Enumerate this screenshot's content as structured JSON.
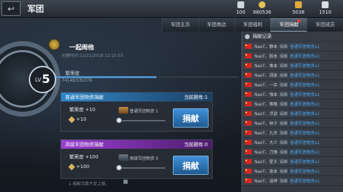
{
  "header": {
    "back_icon": "back-arrow-icon",
    "title": "军团",
    "resources": [
      {
        "icon": "silver-bar-icon",
        "value": "100",
        "color": "#cfd6dc"
      },
      {
        "icon": "coin-icon",
        "value": "980536",
        "color": "#e2c35a"
      },
      {
        "icon": "gold-bar-icon",
        "value": "5038",
        "color": "#e0a93a"
      },
      {
        "icon": "ticket-icon",
        "value": "1510",
        "color": "#d9dee4"
      }
    ]
  },
  "tabs": [
    {
      "label": "军团主页",
      "active": false
    },
    {
      "label": "军团商店",
      "active": false
    },
    {
      "label": "军团福利",
      "active": false
    },
    {
      "label": "军团捐献",
      "active": true,
      "badge": true
    },
    {
      "label": "军团成员",
      "active": false
    }
  ],
  "player": {
    "name": "一起闹他",
    "created": "创建时间:11/21/2018 12:15:03"
  },
  "level": {
    "label": "LV",
    "value": "5"
  },
  "prosperity": {
    "label": "繁荣度",
    "value": "74140/135379",
    "progress": 0.548
  },
  "donations": [
    {
      "title": "普通军团物资捐献",
      "remaining": "当前拥有:1",
      "prosperity_gain": "繁荣度 +10",
      "resource_gain": "+10",
      "supply_text": "普通军团物资  1",
      "button": "捐献",
      "color": "#2f86c8"
    },
    {
      "title": "高级军团物资捐献",
      "remaining": "当前拥有:0",
      "prosperity_gain": "繁荣度 +100",
      "resource_gain": "+100",
      "supply_text": "高级军团物资  0",
      "button": "捐献",
      "color": "#9a3fd1"
    }
  ],
  "bottom_hint": "1.捐献次数不足上限,",
  "bottom_hint_2": "",
  "log": {
    "title": "捐献记录",
    "rows": [
      {
        "name": "NaoT、静本",
        "action": "捐献",
        "item": "普通军团物资x1"
      },
      {
        "name": "NaoT、毅本",
        "action": "捐献",
        "item": "普通军团物资x1"
      },
      {
        "name": "NaoT、毒本",
        "action": "捐献",
        "item": "普通军团物资x1"
      },
      {
        "name": "NaoT、翊泉",
        "action": "捐献",
        "item": "普通军团物资x1"
      },
      {
        "name": "NaoT、一旦",
        "action": "捐献",
        "item": "普通军团物资x1"
      },
      {
        "name": "NaoT、强本",
        "action": "捐献",
        "item": "普通军团物资x1"
      },
      {
        "name": "NaoT、策略",
        "action": "捐献",
        "item": "普通军团物资x1"
      },
      {
        "name": "NaoT、浮游",
        "action": "捐献",
        "item": "普通军团物资x1"
      },
      {
        "name": "NaoT、林夕",
        "action": "捐献",
        "item": "普通军团物资x1"
      },
      {
        "name": "NaoT、九天",
        "action": "捐献",
        "item": "普通军团物资x1"
      },
      {
        "name": "NaoT、大少",
        "action": "捐献",
        "item": "普通军团物资x1"
      },
      {
        "name": "NaoT、刀锋",
        "action": "捐献",
        "item": "普通军团物资x1"
      },
      {
        "name": "NaoT、星王",
        "action": "捐献",
        "item": "普通军团物资x1"
      },
      {
        "name": "NaoT、夜本",
        "action": "捐献",
        "item": "普通军团物资x1"
      },
      {
        "name": "NaoT、战神",
        "action": "捐献",
        "item": "普通军团物资x1"
      }
    ]
  }
}
